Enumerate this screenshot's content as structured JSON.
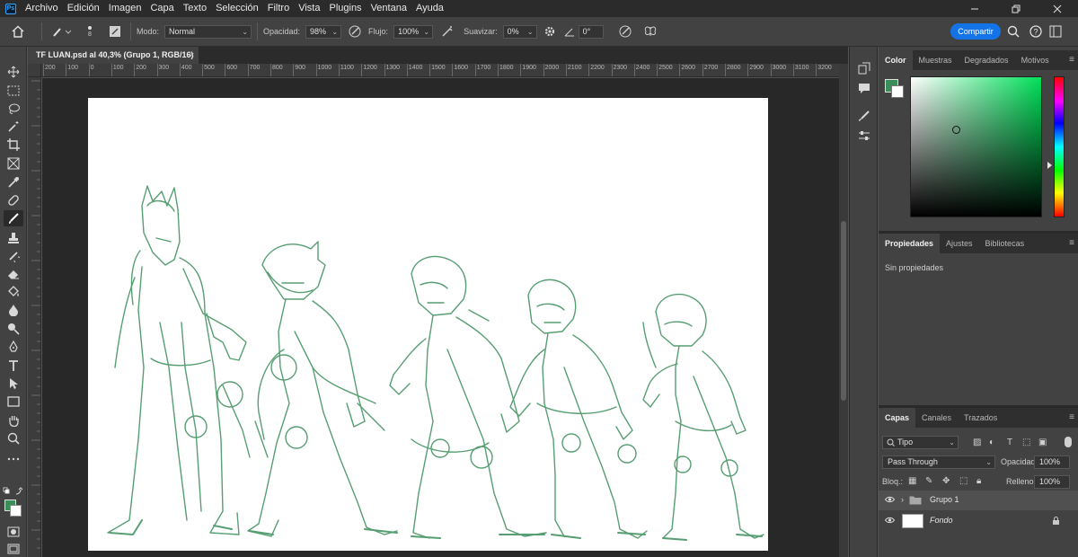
{
  "menubar": {
    "items": [
      "Archivo",
      "Edición",
      "Imagen",
      "Capa",
      "Texto",
      "Selección",
      "Filtro",
      "Vista",
      "Plugins",
      "Ventana",
      "Ayuda"
    ]
  },
  "options": {
    "brush_size": "8",
    "mode_label": "Modo:",
    "mode_value": "Normal",
    "opacity_label": "Opacidad:",
    "opacity_value": "98%",
    "flow_label": "Flujo:",
    "flow_value": "100%",
    "smooth_label": "Suavizar:",
    "smooth_value": "0%",
    "angle_value": "0°",
    "share_label": "Compartir"
  },
  "document": {
    "tab_title": "TF LUAN.psd al 40,3% (Grupo 1, RGB/16)",
    "close": "×"
  },
  "ruler": {
    "top_labels": [
      "200",
      "100",
      "0",
      "100",
      "200",
      "300",
      "400",
      "500",
      "600",
      "700",
      "800",
      "900",
      "1000",
      "1100",
      "1200",
      "1300",
      "1400",
      "1500",
      "1600",
      "1700",
      "1800",
      "1900",
      "2000",
      "2100",
      "2200",
      "2300",
      "2400",
      "2500",
      "2600",
      "2700",
      "2800",
      "2900",
      "3000",
      "3100",
      "3200"
    ]
  },
  "color_panel": {
    "tabs": [
      "Color",
      "Muestras",
      "Degradados",
      "Motivos"
    ],
    "foreground": "#3a8e5a",
    "background": "#ffffff"
  },
  "properties_panel": {
    "tabs": [
      "Propiedades",
      "Ajustes",
      "Bibliotecas"
    ],
    "empty_text": "Sin propiedades"
  },
  "layers_panel": {
    "tabs": [
      "Capas",
      "Canales",
      "Trazados"
    ],
    "filter_value": "Tipo",
    "blend_mode": "Pass Through",
    "opacity_label": "Opacidad:",
    "opacity_value": "100%",
    "lock_label": "Bloq.:",
    "fill_label": "Relleno:",
    "fill_value": "100%",
    "layers": [
      {
        "name": "Grupo 1",
        "type": "group",
        "selected": true
      },
      {
        "name": "Fondo",
        "type": "background",
        "selected": false
      }
    ]
  },
  "colors": {
    "accent": "#1473e6",
    "sketch_stroke": "#3a8e5a"
  }
}
